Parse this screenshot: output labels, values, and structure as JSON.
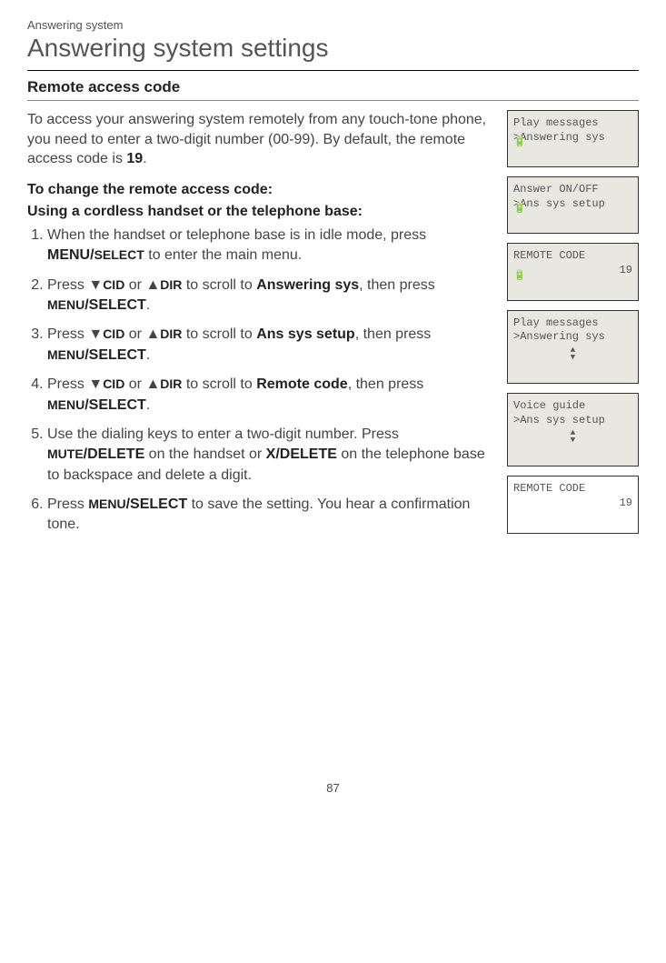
{
  "header": {
    "section_label": "Answering system",
    "title": "Answering system settings"
  },
  "subtitle": "Remote access code",
  "intro": {
    "line1": "To access your answering system remotely from any touch-tone phone, you need to enter a two-digit number (00-99). By default, the remote access code is ",
    "code": "19",
    "period": "."
  },
  "change_head": "To change the remote access code:",
  "using_head": "Using a cordless handset or the telephone base:",
  "steps": {
    "s1a": "When the handset or telephone base is in idle mode, press ",
    "s1b": "MENU/",
    "s1c": "SELECT",
    "s1d": " to enter the main menu.",
    "s2a": "Press ",
    "s2cid": "CID",
    "s2or": " or ",
    "s2dir": "DIR",
    "s2b": " to scroll to ",
    "s2target": "Answering sys",
    "s2c": ", then press ",
    "s2menu": "MENU",
    "s2select": "/SELECT",
    "s2end": ".",
    "s3target": "Ans sys setup",
    "s4target": "Remote code",
    "s4end": ", then press ",
    "s5a": "Use the dialing keys to enter a two-digit number. Press ",
    "s5mute": "MUTE",
    "s5del": "/DELETE",
    "s5b": " on the handset or ",
    "s5x": "X/DELETE",
    "s5c": " on the telephone base to backspace and delete a digit.",
    "s6a": "Press ",
    "s6b": " to save the setting. You hear a confirmation tone."
  },
  "displays": {
    "d1": {
      "l1": " Play messages",
      "l2": ">Answering sys"
    },
    "d2": {
      "l1": " Answer ON/OFF",
      "l2": ">Ans sys setup"
    },
    "d3": {
      "l1": "  REMOTE CODE",
      "l2": "19"
    },
    "d4": {
      "l1": " Play messages",
      "l2": ">Answering sys"
    },
    "d5": {
      "l1": " Voice guide",
      "l2": ">Ans sys setup"
    },
    "d6": {
      "l1": "   REMOTE CODE",
      "l2": "19"
    }
  },
  "page_number": "87"
}
